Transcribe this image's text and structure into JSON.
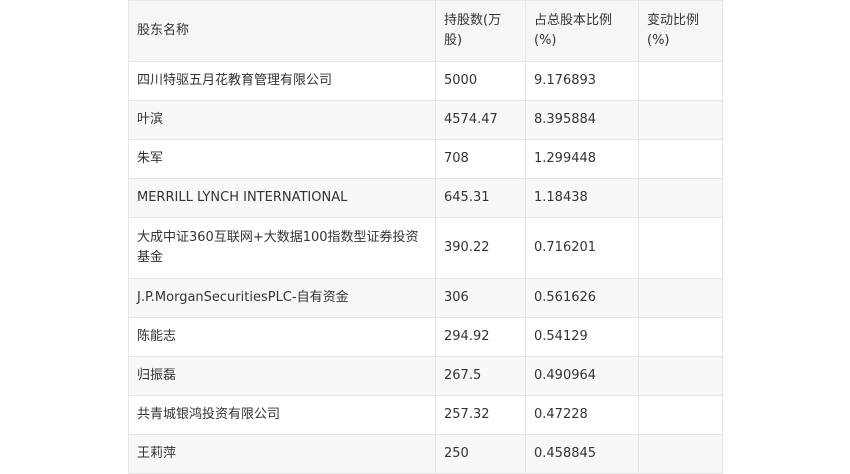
{
  "table": {
    "headers": [
      "股东名称",
      "持股数(万股)",
      "占总股本比例(%)",
      "变动比例(%)"
    ],
    "rows": [
      [
        "四川特驱五月花教育管理有限公司",
        "5000",
        "9.176893",
        ""
      ],
      [
        "叶滨",
        "4574.47",
        "8.395884",
        ""
      ],
      [
        "朱军",
        "708",
        "1.299448",
        ""
      ],
      [
        "MERRILL LYNCH INTERNATIONAL",
        "645.31",
        "1.18438",
        ""
      ],
      [
        "大成中证360互联网+大数据100指数型证券投资基金",
        "390.22",
        "0.716201",
        ""
      ],
      [
        "J.P.MorganSecuritiesPLC-自有资金",
        "306",
        "0.561626",
        ""
      ],
      [
        "陈能志",
        "294.92",
        "0.54129",
        ""
      ],
      [
        "归振磊",
        "267.5",
        "0.490964",
        ""
      ],
      [
        "共青城银鸿投资有限公司",
        "257.32",
        "0.47228",
        ""
      ],
      [
        "王莉萍",
        "250",
        "0.458845",
        ""
      ]
    ]
  }
}
